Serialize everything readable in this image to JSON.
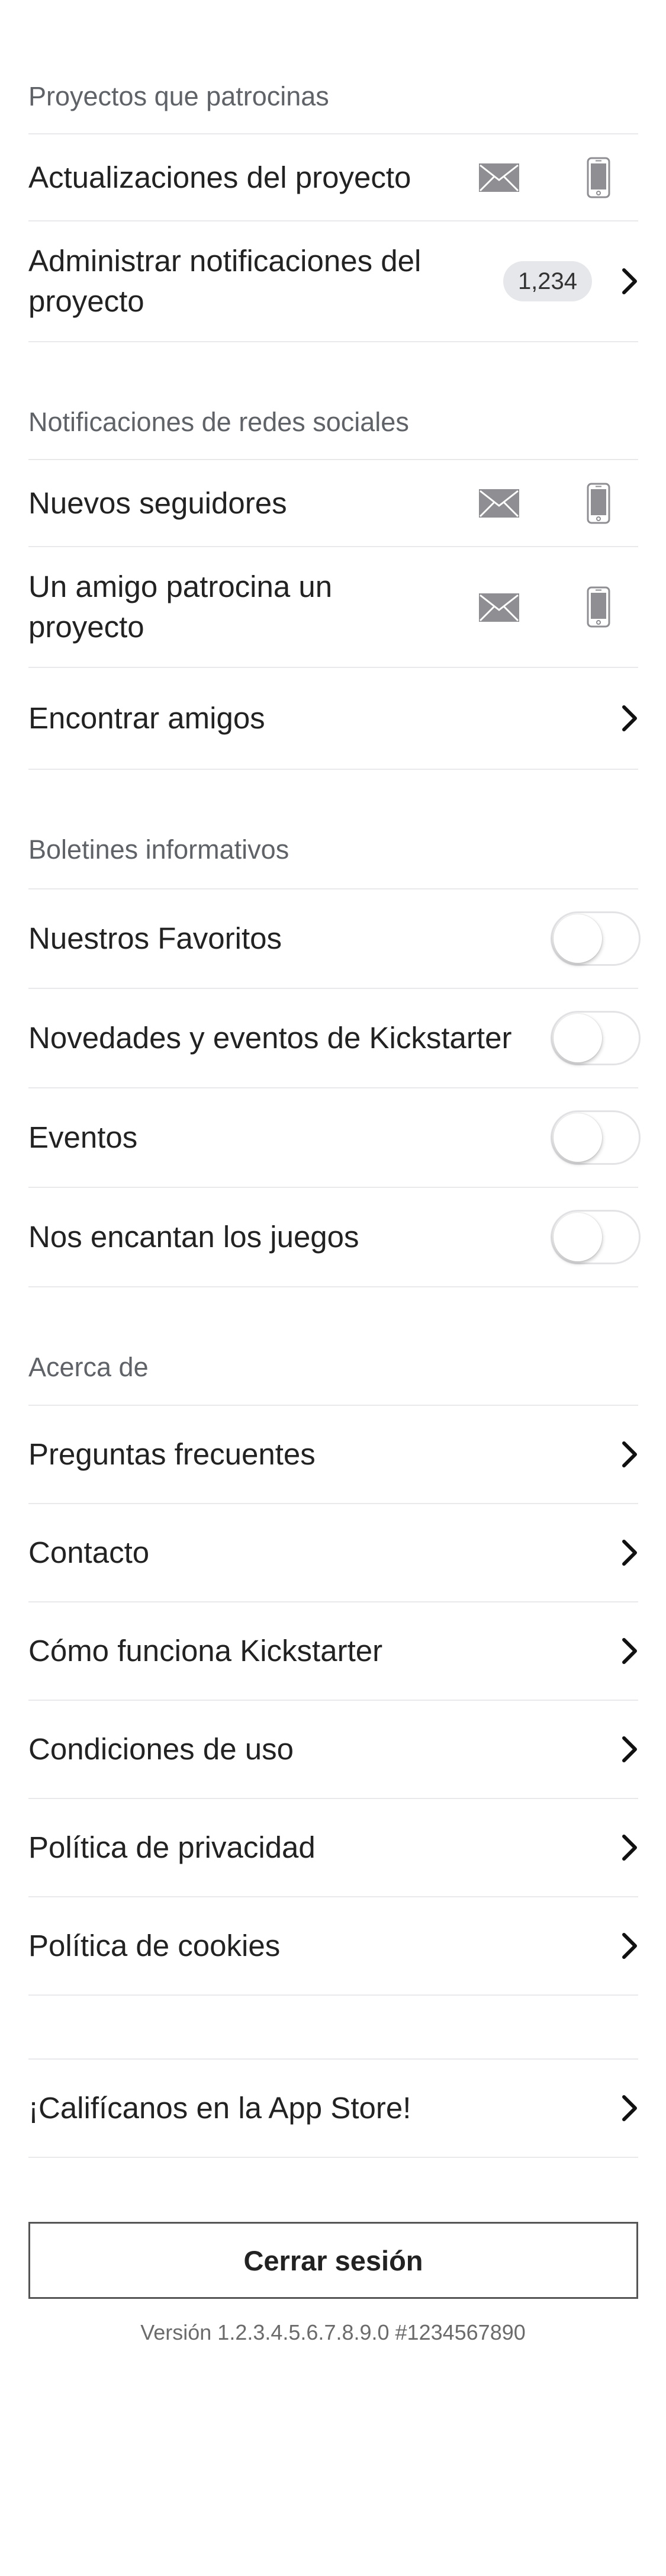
{
  "sections": {
    "backed_projects": {
      "header": "Proyectos que patrocinas",
      "project_updates": "Actualizaciones del proyecto",
      "manage_notifications": "Administrar notificaciones del proyecto",
      "manage_count": "1,234"
    },
    "social": {
      "header": "Notificaciones de redes sociales",
      "new_followers": "Nuevos seguidores",
      "friend_backs": "Un amigo patrocina un proyecto",
      "find_friends": "Encontrar amigos"
    },
    "newsletters": {
      "header": "Boletines informativos",
      "items": [
        {
          "label": "Nuestros Favoritos",
          "enabled": false
        },
        {
          "label": "Novedades y eventos de Kickstarter",
          "enabled": false
        },
        {
          "label": "Eventos",
          "enabled": false
        },
        {
          "label": "Nos encantan los juegos",
          "enabled": false
        }
      ]
    },
    "about": {
      "header": "Acerca de",
      "items": [
        "Preguntas frecuentes",
        "Contacto",
        "Cómo funciona Kickstarter",
        "Condiciones de uso",
        "Política de privacidad",
        "Política de cookies"
      ]
    },
    "rate": {
      "label": "¡Califícanos en la App Store!"
    }
  },
  "logout_label": "Cerrar sesión",
  "version": "Versión 1.2.3.4.5.6.7.8.9.0 #1234567890",
  "icons": {
    "email": "mail-icon",
    "push": "phone-icon",
    "disclosure": "chevron-right-icon"
  },
  "colors": {
    "icon_gray": "#8e8e93",
    "divider": "#e9e9ec",
    "badge_bg": "#e6e7ea"
  }
}
